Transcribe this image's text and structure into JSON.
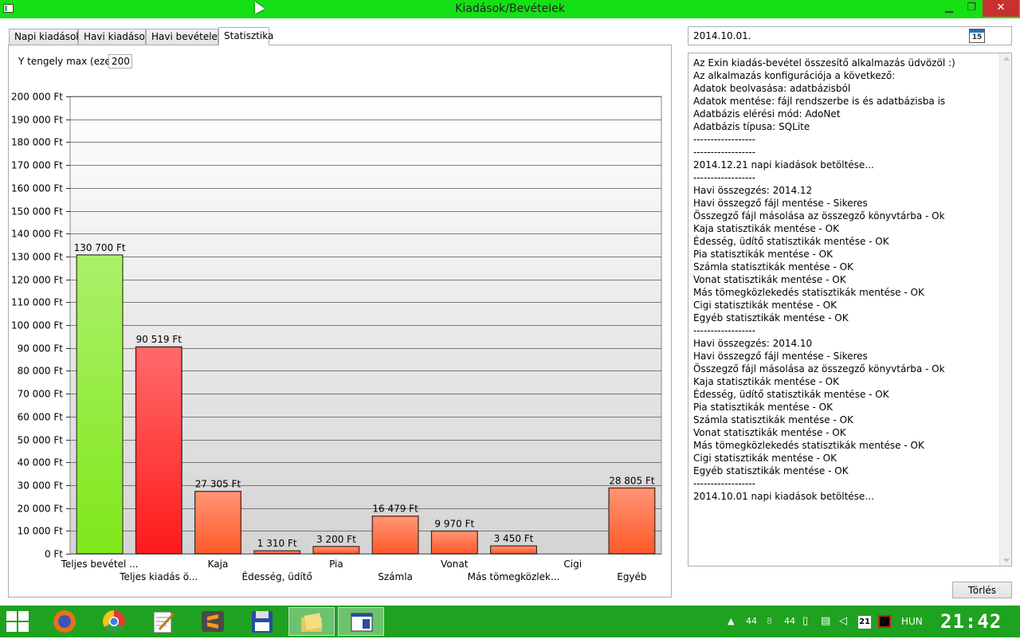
{
  "window": {
    "title": "Kiadások/Bevételek",
    "minimize": "▁",
    "maximize": "❐",
    "close": "✕"
  },
  "tabs": [
    {
      "label": "Napi kiadások"
    },
    {
      "label": "Havi kiadások"
    },
    {
      "label": "Havi bevételek"
    },
    {
      "label": "Statisztika",
      "active": true
    }
  ],
  "controls": {
    "ymax_label": "Y tengely max (ezer):",
    "ymax_value": "200"
  },
  "chart_data": {
    "type": "bar",
    "ylim": [
      0,
      200000
    ],
    "y_tick_step": 10000,
    "y_tick_suffix": " Ft",
    "grid": true,
    "categories": [
      "Teljes bevétel ...",
      "Teljes kiadás ö...",
      "Kaja",
      "Édesség, üdítő",
      "Pia",
      "Számla",
      "Vonat",
      "Más tömegközlek...",
      "Cigi",
      "Egyéb"
    ],
    "values": [
      130700,
      90519,
      27305,
      1310,
      3200,
      16479,
      9970,
      3450,
      0,
      28805
    ],
    "value_labels": [
      "130 700 Ft",
      "90 519 Ft",
      "27 305 Ft",
      "1 310 Ft",
      "3 200 Ft",
      "16 479 Ft",
      "9 970 Ft",
      "3 450 Ft",
      "",
      "28 805 Ft"
    ],
    "colors": [
      "#7fe81a",
      "#ff1a1a",
      "#ff5a2a",
      "#ff5a2a",
      "#ff5a2a",
      "#ff5a2a",
      "#ff5a2a",
      "#ff5a2a",
      "#ff5a2a",
      "#ff5a2a"
    ]
  },
  "date": {
    "value": "2014.10.01.",
    "calendar_day": "15"
  },
  "log": [
    "Az Exin kiadás-bevétel összesítő alkalmazás üdvözöl :)",
    "Az alkalmazás konfigurációja a következő:",
    "Adatok beolvasása: adatbázisból",
    "Adatok mentése: fájl rendszerbe is és adatbázisba is",
    "Adatbázis elérési mód: AdoNet",
    "Adatbázis típusa: SQLite",
    "------------------",
    "------------------",
    "2014.12.21 napi kiadások betöltése...",
    "------------------",
    "Havi összegzés: 2014.12",
    "Havi összegző fájl mentése - Sikeres",
    "Összegző fájl másolása az összegző könyvtárba - Ok",
    "Kaja statisztikák mentése - OK",
    "Édesség, üdítő statisztikák mentése - OK",
    "Pia statisztikák mentése - OK",
    "Számla statisztikák mentése - OK",
    "Vonat statisztikák mentése - OK",
    "Más tömegközlekedés statisztikák mentése - OK",
    "Cigi statisztikák mentése - OK",
    "Egyéb statisztikák mentése - OK",
    "------------------",
    "Havi összegzés: 2014.10",
    "Havi összegző fájl mentése - Sikeres",
    "Összegző fájl másolása az összegző könyvtárba - Ok",
    "Kaja statisztikák mentése - OK",
    "Édesség, üdítő statisztikák mentése - OK",
    "Pia statisztikák mentése - OK",
    "Számla statisztikák mentése - OK",
    "Vonat statisztikák mentése - OK",
    "Más tömegközlekedés statisztikák mentése - OK",
    "Cigi statisztikák mentése - OK",
    "Egyéb statisztikák mentése - OK",
    "------------------",
    "2014.10.01 napi kiadások betöltése..."
  ],
  "buttons": {
    "clear": "Törlés"
  },
  "taskbar": {
    "apps": [
      "firefox-icon",
      "chrome-icon",
      "notepad-icon",
      "sublime-icon",
      "floppy-icon",
      "explorer-icon",
      "app-window-icon"
    ],
    "tray": {
      "temp1": "44",
      "cpu": "8",
      "temp2": "44",
      "calendar_day": "21",
      "language": "HUN"
    },
    "clock": "21:42"
  }
}
